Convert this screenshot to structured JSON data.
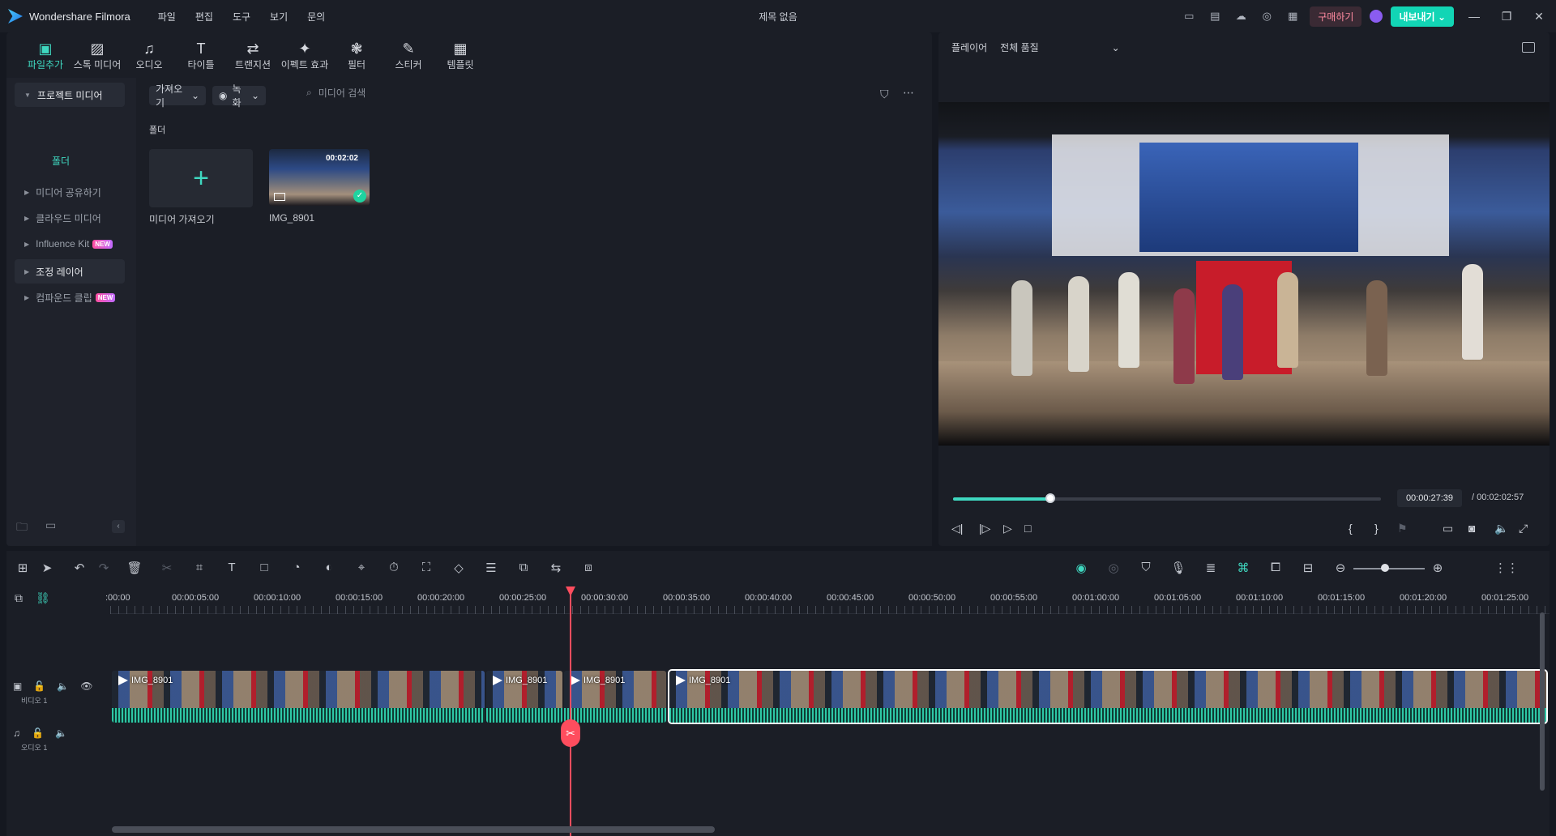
{
  "app": {
    "name": "Wondershare Filmora",
    "doc_title": "제목 없음",
    "menu": [
      "파일",
      "편집",
      "도구",
      "보기",
      "문의"
    ],
    "buy_label": "구매하기",
    "export_label": "내보내기",
    "colors": {
      "accent": "#3fd8c0",
      "export": "#12d5b5",
      "playhead": "#ff4d5e",
      "buy_text": "#ff8aa0"
    }
  },
  "media": {
    "tabs": [
      {
        "label": "파일추가",
        "icon": "import-media-icon",
        "glyph": "▣"
      },
      {
        "label": "스톡 미디어",
        "icon": "stock-media-icon",
        "glyph": "▨"
      },
      {
        "label": "오디오",
        "icon": "audio-icon",
        "glyph": "♫"
      },
      {
        "label": "타이틀",
        "icon": "title-icon",
        "glyph": "T"
      },
      {
        "label": "트랜지션",
        "icon": "transition-icon",
        "glyph": "⇄"
      },
      {
        "label": "이펙트 효과",
        "icon": "effects-icon",
        "glyph": "✦"
      },
      {
        "label": "필터",
        "icon": "filter-icon",
        "glyph": "❃"
      },
      {
        "label": "스티커",
        "icon": "sticker-icon",
        "glyph": "✎"
      },
      {
        "label": "템플릿",
        "icon": "template-icon",
        "glyph": "▦"
      }
    ],
    "sidebar": {
      "project_media": "프로젝트 미디어",
      "folder": "폴더",
      "shared_media": "미디어 공유하기",
      "cloud_media": "클라우드 미디어",
      "influence_kit": "Influence Kit",
      "adjustment_layer": "조정 레이어",
      "compound_clip": "컴파운드 클립",
      "new_badge": "NEW"
    },
    "toolbar": {
      "import": "가져오기",
      "record": "녹화",
      "search_placeholder": "미디어 검색"
    },
    "content_label": "폴더",
    "import_tile_label": "미디어 가져오기",
    "items": [
      {
        "name": "IMG_8901",
        "duration": "00:02:02"
      }
    ]
  },
  "player": {
    "label": "플레이어",
    "quality": "전체 품질",
    "current_time": "00:00:27:39",
    "total_time": "/ 00:02:02:57",
    "progress_fraction": 0.2266
  },
  "timeline": {
    "ruler_labels": [
      ":00:00",
      "00:00:05:00",
      "00:00:10:00",
      "00:00:15:00",
      "00:00:20:00",
      "00:00:25:00",
      "00:00:30:00",
      "00:00:35:00",
      "00:00:40:00",
      "00:00:45:00",
      "00:00:50:00",
      "00:00:55:00",
      "00:01:00:00",
      "00:01:05:00",
      "00:01:10:00",
      "00:01:15:00",
      "00:01:20:00",
      "00:01:25:00"
    ],
    "tracks": {
      "video_label": "비디오 1",
      "audio_label": "오디오 1"
    },
    "clips": [
      {
        "label": "IMG_8901"
      },
      {
        "label": "IMG_8901"
      },
      {
        "label": "IMG_8901"
      },
      {
        "label": "IMG_8901"
      }
    ]
  }
}
